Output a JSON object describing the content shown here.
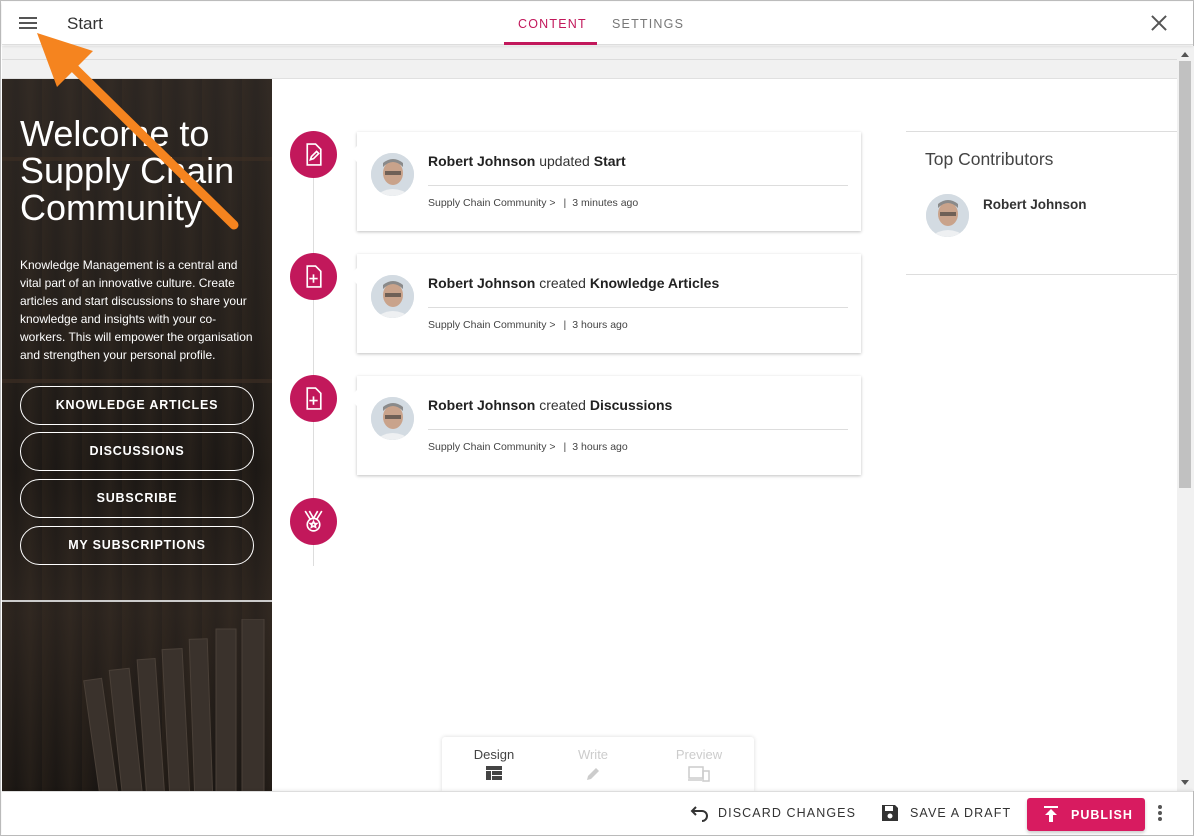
{
  "header": {
    "title": "Start",
    "tabs": [
      {
        "label": "CONTENT",
        "active": true
      },
      {
        "label": "SETTINGS",
        "active": false
      }
    ],
    "menu_icon": "hamburger-menu-icon",
    "close_icon": "close-icon"
  },
  "hero": {
    "title": "Welcome to Supply Chain Community",
    "text": "Knowledge Management is a central and vital part of an innovative culture. Create articles and start discussions to share your knowledge and insights with your co-workers. This will empower the organisation and strengthen your personal profile.",
    "buttons": [
      {
        "label": "KNOWLEDGE ARTICLES"
      },
      {
        "label": "DISCUSSIONS"
      },
      {
        "label": "SUBSCRIBE"
      },
      {
        "label": "MY SUBSCRIPTIONS"
      }
    ]
  },
  "feed": [
    {
      "user": "Robert Johnson",
      "action": "updated",
      "target": "Start",
      "community": "Supply Chain Community >",
      "time": "3 minutes ago",
      "icon": "edit-document-icon"
    },
    {
      "user": "Robert Johnson",
      "action": "created",
      "target": "Knowledge Articles",
      "community": "Supply Chain Community >",
      "time": "3 hours ago",
      "icon": "add-document-icon"
    },
    {
      "user": "Robert Johnson",
      "action": "created",
      "target": "Discussions",
      "community": "Supply Chain Community >",
      "time": "3 hours ago",
      "icon": "add-document-icon"
    }
  ],
  "timeline_end_icon": "medal-icon",
  "contributors": {
    "title": "Top Contributors",
    "items": [
      {
        "name": "Robert Johnson"
      }
    ]
  },
  "mode_switch": {
    "modes": [
      {
        "label": "Design",
        "active": true,
        "icon": "layout-icon"
      },
      {
        "label": "Write",
        "active": false,
        "icon": "pencil-icon"
      },
      {
        "label": "Preview",
        "active": false,
        "icon": "devices-icon"
      }
    ]
  },
  "footer": {
    "discard_label": "DISCARD CHANGES",
    "draft_label": "SAVE A DRAFT",
    "publish_label": "PUBLISH"
  },
  "colors": {
    "accent": "#c2185b",
    "publish": "#d81b60",
    "annotation_arrow": "#f5841f"
  }
}
